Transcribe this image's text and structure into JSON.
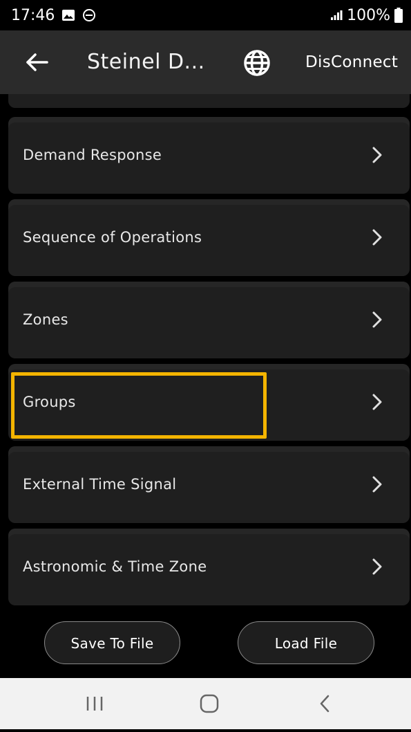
{
  "status_bar": {
    "time": "17:46",
    "battery": "100%"
  },
  "app_bar": {
    "title": "Steinel D...",
    "disconnect_label": "DisConnect"
  },
  "menu": {
    "items": [
      {
        "label": "Demand Response"
      },
      {
        "label": "Sequence of Operations"
      },
      {
        "label": "Zones"
      },
      {
        "label": "Groups"
      },
      {
        "label": "External Time Signal"
      },
      {
        "label": "Astronomic & Time Zone"
      }
    ]
  },
  "actions": {
    "save_label": "Save To File",
    "load_label": "Load File"
  },
  "colors": {
    "highlight": "#f4b400",
    "app_bar_bg": "#2b2b2b",
    "card_bg": "#1f1f1f",
    "nav_bar_bg": "#f2f2f2"
  },
  "icons": [
    "image-icon",
    "do-not-disturb-icon",
    "signal-icon",
    "battery-icon",
    "back-arrow-icon",
    "globe-icon",
    "chevron-right-icon",
    "recent-apps-icon",
    "home-icon",
    "back-nav-icon"
  ]
}
